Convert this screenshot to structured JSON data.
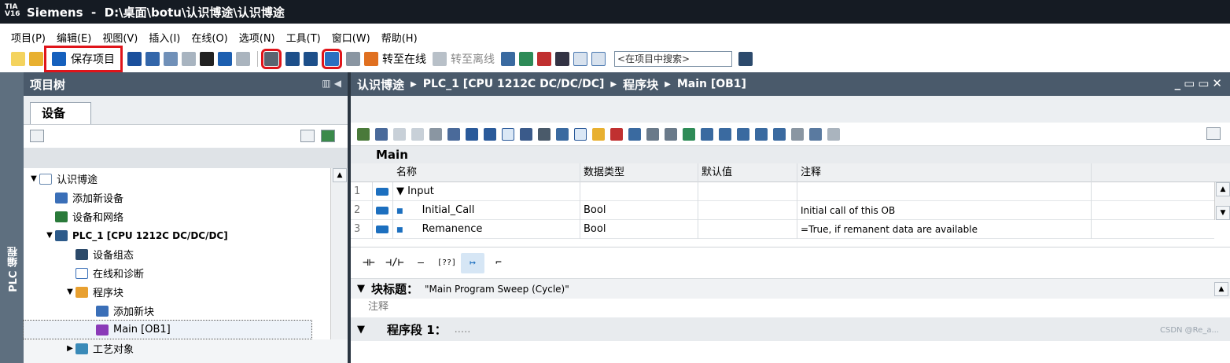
{
  "window": {
    "app_logo": "TIA V16",
    "title": "Siemens  -  D:\\桌面\\botu\\认识博途\\认识博途"
  },
  "menu": [
    "项目(P)",
    "编辑(E)",
    "视图(V)",
    "插入(I)",
    "在线(O)",
    "选项(N)",
    "工具(T)",
    "窗口(W)",
    "帮助(H)"
  ],
  "toolbar": {
    "save_label": "保存项目",
    "go_online": "转至在线",
    "go_offline": "转至离线",
    "search_placeholder": "<在项目中搜索>"
  },
  "left_strip_label": "PLC 编程",
  "project_tree": {
    "header": "项目树",
    "tab": "设备",
    "items": [
      {
        "label": "认识博途",
        "indent": 0,
        "arrow": "▼",
        "icon": "project-icon"
      },
      {
        "label": "添加新设备",
        "indent": 1,
        "arrow": "",
        "icon": "add-device-icon"
      },
      {
        "label": "设备和网络",
        "indent": 1,
        "arrow": "",
        "icon": "network-icon"
      },
      {
        "label": "PLC_1 [CPU 1212C DC/DC/DC]",
        "indent": 1,
        "arrow": "▼",
        "icon": "plc-icon"
      },
      {
        "label": "设备组态",
        "indent": 2,
        "arrow": "",
        "icon": "device-config-icon"
      },
      {
        "label": "在线和诊断",
        "indent": 2,
        "arrow": "",
        "icon": "diagnostics-icon"
      },
      {
        "label": "程序块",
        "indent": 2,
        "arrow": "▼",
        "icon": "program-blocks-icon"
      },
      {
        "label": "添加新块",
        "indent": 3,
        "arrow": "",
        "icon": "add-block-icon"
      },
      {
        "label": "Main [OB1]",
        "indent": 3,
        "arrow": "",
        "icon": "ob-icon",
        "selected": true
      },
      {
        "label": "工艺对象",
        "indent": 2,
        "arrow": "▶",
        "icon": "tech-objects-icon"
      }
    ]
  },
  "editor": {
    "breadcrumb": [
      "认识博途",
      "PLC_1 [CPU 1212C DC/DC/DC]",
      "程序块",
      "Main [OB1]"
    ],
    "block_name": "Main",
    "interface": {
      "columns": [
        "名称",
        "数据类型",
        "默认值",
        "注释"
      ],
      "rows": [
        {
          "num": "1",
          "expander": "▼",
          "name": "Input",
          "type": "",
          "default": "",
          "comment": ""
        },
        {
          "num": "2",
          "expander": "■",
          "name": "Initial_Call",
          "type": "Bool",
          "default": "",
          "comment": "Initial call of this OB"
        },
        {
          "num": "3",
          "expander": "■",
          "name": "Remanence",
          "type": "Bool",
          "default": "",
          "comment": "=True, if remanent data are available"
        }
      ]
    },
    "ladder_tools": [
      "⊣⊢",
      "⊣/⊢",
      "–()–",
      "[??]",
      "↦",
      "⌐"
    ],
    "block_title_label": "块标题：",
    "block_title_value": "\"Main Program Sweep (Cycle)\"",
    "comment_label": "注释",
    "network_label": "程序段 1：",
    "network_dots": "....."
  },
  "watermark": "CSDN @Re_a..."
}
